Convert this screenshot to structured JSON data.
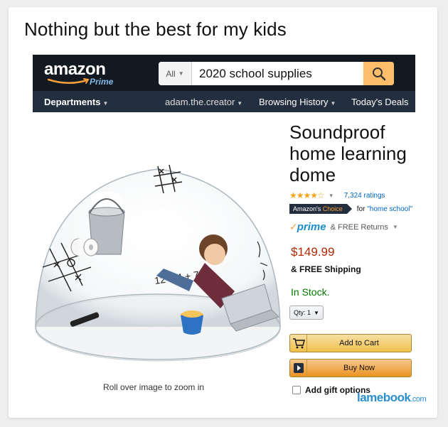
{
  "meme": {
    "caption": "Nothing but the best for my kids",
    "watermark": "lamebook",
    "watermark_suffix": ".com"
  },
  "header": {
    "logo_word": "amazon",
    "logo_sub": "Prime",
    "search": {
      "category": "All",
      "query": "2020 school supplies"
    },
    "nav": {
      "departments": "Departments",
      "user": "adam.the.creator",
      "history": "Browsing History",
      "deals": "Today's Deals"
    }
  },
  "product": {
    "title_lines": [
      "Soundproof",
      "home learning",
      "dome"
    ],
    "stars": "★★★★☆",
    "rating_value": 4.5,
    "ratings_count": "7,324 ratings",
    "badge_prefix": "Amazon's",
    "badge_suffix": "Choice",
    "badge_for": "for",
    "badge_query": "\"home school\"",
    "prime_word": "prime",
    "prime_returns": "& FREE Returns",
    "price": "$149.99",
    "shipping": "& FREE Shipping",
    "stock": "In Stock.",
    "qty": "Qty: 1",
    "add_to_cart": "Add to Cart",
    "buy_now": "Buy Now",
    "gift": "Add gift options",
    "zoom_hint": "Roll over image to zoom in",
    "image_equation": "12 = 4 + 7"
  },
  "colors": {
    "header_top": "#131921",
    "header_nav": "#232f3e",
    "search_button": "#febd69",
    "price": "#b12704",
    "stock": "#007600",
    "link": "#0066c0",
    "prime": "#1d8dc9"
  }
}
